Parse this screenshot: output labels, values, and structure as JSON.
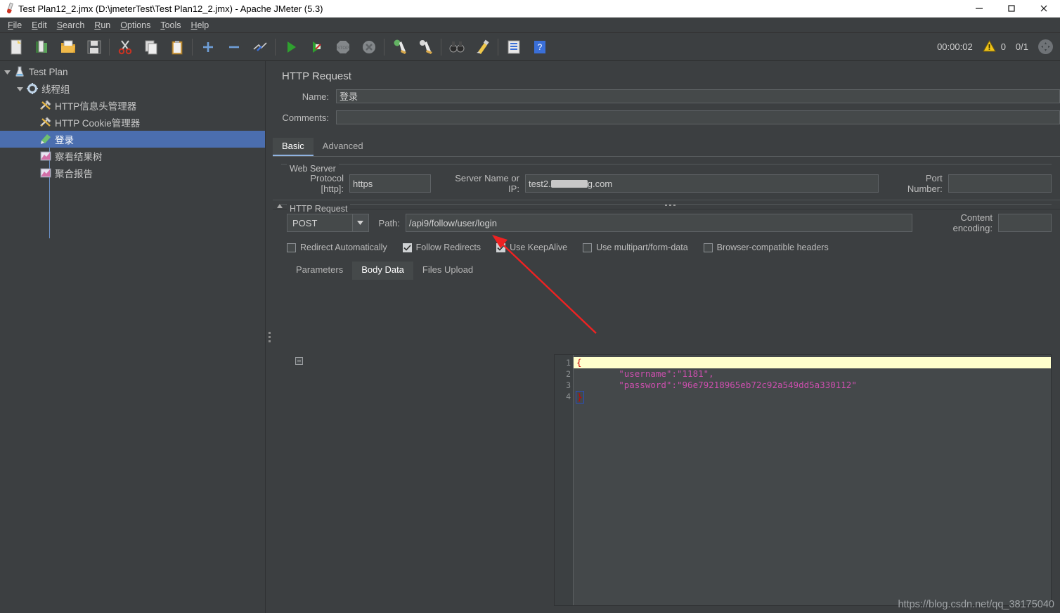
{
  "window": {
    "title": "Test Plan12_2.jmx (D:\\jmeterTest\\Test Plan12_2.jmx) - Apache JMeter (5.3)",
    "app_icon": "jmeter-icon",
    "minimize": "minimize-icon",
    "maximize": "maximize-icon",
    "close": "close-icon"
  },
  "menubar": {
    "items": [
      {
        "label": "File",
        "mnemonic": "F"
      },
      {
        "label": "Edit",
        "mnemonic": "E"
      },
      {
        "label": "Search",
        "mnemonic": "S"
      },
      {
        "label": "Run",
        "mnemonic": "R"
      },
      {
        "label": "Options",
        "mnemonic": "O"
      },
      {
        "label": "Tools",
        "mnemonic": "T"
      },
      {
        "label": "Help",
        "mnemonic": "H"
      }
    ]
  },
  "toolbar": {
    "buttons": [
      {
        "name": "new-button",
        "icon": "new-file-icon"
      },
      {
        "name": "templates-button",
        "icon": "templates-icon"
      },
      {
        "name": "open-button",
        "icon": "open-folder-icon"
      },
      {
        "name": "save-button",
        "icon": "save-disk-icon"
      },
      {
        "name": "cut-button",
        "icon": "scissors-icon"
      },
      {
        "name": "copy-button",
        "icon": "copy-icon"
      },
      {
        "name": "paste-button",
        "icon": "clipboard-icon"
      },
      {
        "name": "expand-button",
        "icon": "plus-icon"
      },
      {
        "name": "collapse-button",
        "icon": "minus-icon"
      },
      {
        "name": "toggle-button",
        "icon": "toggle-icon"
      },
      {
        "name": "start-button",
        "icon": "play-green-icon"
      },
      {
        "name": "start-no-pauses-button",
        "icon": "play-no-pauses-icon"
      },
      {
        "name": "stop-button",
        "icon": "stop-icon"
      },
      {
        "name": "shutdown-button",
        "icon": "shutdown-icon"
      },
      {
        "name": "clear-button",
        "icon": "broom-green-icon"
      },
      {
        "name": "clear-all-button",
        "icon": "broom-all-icon"
      },
      {
        "name": "search-button",
        "icon": "binoculars-icon"
      },
      {
        "name": "reset-search-button",
        "icon": "clear-search-icon"
      },
      {
        "name": "function-helper-button",
        "icon": "function-helper-icon"
      },
      {
        "name": "help-button",
        "icon": "help-icon"
      }
    ],
    "status": {
      "elapsed": "00:00:02",
      "warning_icon": "warning-triangle-icon",
      "warning_count": "0",
      "threads": "0/1",
      "error_icon": "error-indicator-icon"
    }
  },
  "tree": {
    "nodes": [
      {
        "label": "Test Plan",
        "icon": "test-plan-icon",
        "indent": 0,
        "toggle": "expanded",
        "selected": false
      },
      {
        "label": "线程组",
        "icon": "thread-group-icon",
        "indent": 1,
        "toggle": "expanded",
        "selected": false
      },
      {
        "label": "HTTP信息头管理器",
        "icon": "header-manager-icon",
        "indent": 2,
        "toggle": "none",
        "selected": false
      },
      {
        "label": "HTTP Cookie管理器",
        "icon": "cookie-manager-icon",
        "indent": 2,
        "toggle": "none",
        "selected": false
      },
      {
        "label": "登录",
        "icon": "http-sampler-icon",
        "indent": 2,
        "toggle": "none",
        "selected": true
      },
      {
        "label": "察看结果树",
        "icon": "view-results-tree-icon",
        "indent": 2,
        "toggle": "none",
        "selected": false
      },
      {
        "label": "聚合报告",
        "icon": "aggregate-report-icon",
        "indent": 2,
        "toggle": "none",
        "selected": false
      }
    ]
  },
  "editor_panel": {
    "title": "HTTP Request",
    "name_label": "Name:",
    "name_value": "登录",
    "comments_label": "Comments:",
    "comments_value": "",
    "splitbar": {
      "up_icon": "collapse-up-icon",
      "down_icon": "expand-down-icon",
      "grip_icon": "grip-dots-icon"
    },
    "tabs": [
      {
        "label": "Basic",
        "active": true
      },
      {
        "label": "Advanced",
        "active": false
      }
    ],
    "web_server": {
      "group_title": "Web Server",
      "protocol_label": "Protocol [http]:",
      "protocol_value": "https",
      "server_label": "Server Name or IP:",
      "server_value_prefix": "test2.",
      "server_value_suffix": "g.com",
      "port_label": "Port Number:",
      "port_value": ""
    },
    "http_request": {
      "group_title": "HTTP Request",
      "method": "POST",
      "method_dropdown_icon": "chevron-down-icon",
      "path_label": "Path:",
      "path_value": "/api9/follow/user/login",
      "content_encoding_label": "Content encoding:",
      "content_encoding_value": "",
      "checkboxes": [
        {
          "label": "Redirect Automatically",
          "checked": false
        },
        {
          "label": "Follow Redirects",
          "checked": true
        },
        {
          "label": "Use KeepAlive",
          "checked": true
        },
        {
          "label": "Use multipart/form-data",
          "checked": false
        },
        {
          "label": "Browser-compatible headers",
          "checked": false
        }
      ]
    },
    "body_tabs": [
      {
        "label": "Parameters",
        "active": false
      },
      {
        "label": "Body Data",
        "active": true
      },
      {
        "label": "Files Upload",
        "active": false
      }
    ],
    "body_data": {
      "line_numbers": [
        "1",
        "2",
        "3",
        "4"
      ],
      "lines": [
        {
          "text": "{",
          "type": "brace-open",
          "highlighted": true
        },
        {
          "text": "        \"username\":\"1181\",",
          "type": "json",
          "highlighted": false
        },
        {
          "text": "        \"password\":\"96e79218965eb72c92a549dd5a330112\"",
          "type": "json",
          "highlighted": false
        },
        {
          "text": "}",
          "type": "brace-close",
          "highlighted": false
        }
      ],
      "fold_marker": "fold-collapse-icon"
    }
  },
  "annotation": {
    "arrow_color": "#ee2222",
    "arrow_name": "red-pointer-arrow"
  },
  "watermark": {
    "text": "https://blog.csdn.net/qq_38175040"
  },
  "colors": {
    "background": "#3c3f41",
    "selection": "#4b6eaf",
    "field": "#45494a",
    "highlight": "#ffffcc",
    "string": "#cc4fae",
    "brace": "#cc0000"
  }
}
